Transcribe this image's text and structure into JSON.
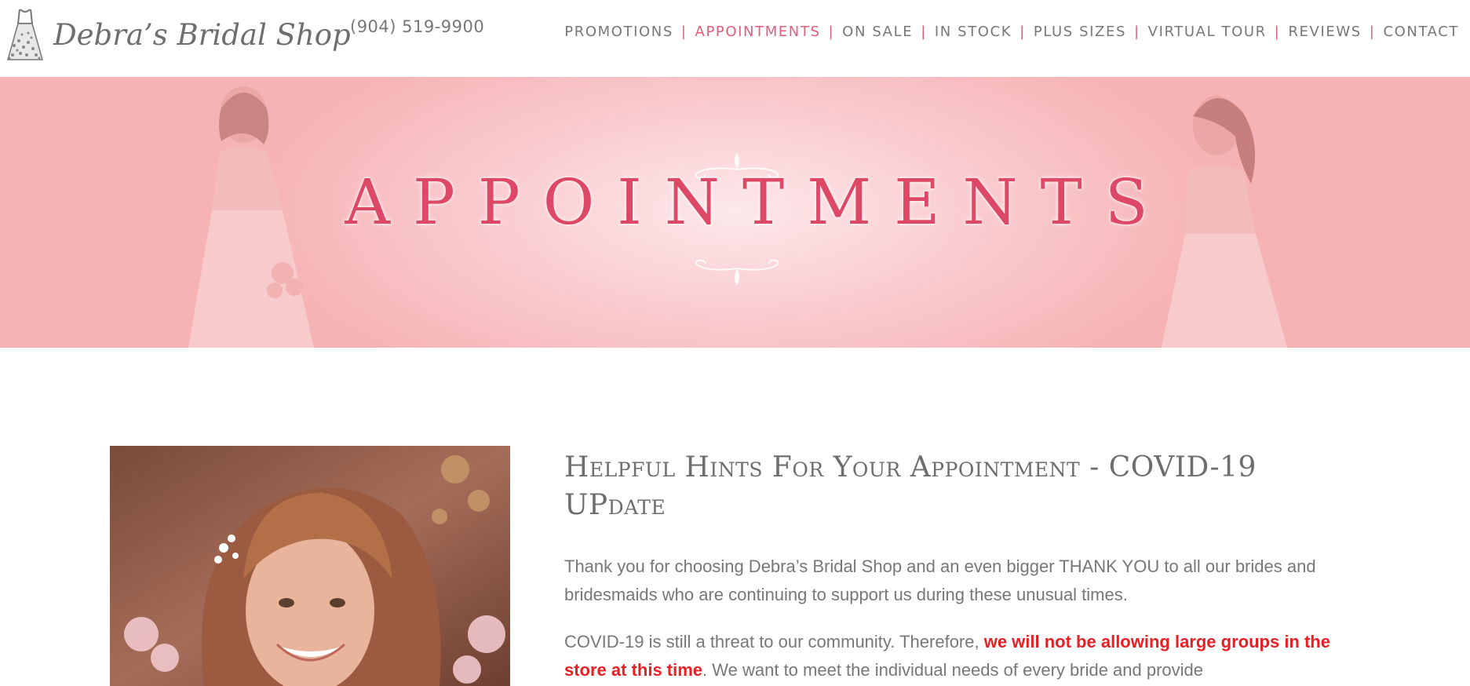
{
  "header": {
    "logo_text": "Debra’s Bridal Shop",
    "phone": "(904) 519-9900",
    "nav": [
      {
        "label": "PROMOTIONS",
        "active": false
      },
      {
        "label": "APPOINTMENTS",
        "active": true
      },
      {
        "label": "ON SALE",
        "active": false
      },
      {
        "label": "IN STOCK",
        "active": false
      },
      {
        "label": "PLUS SIZES",
        "active": false
      },
      {
        "label": "VIRTUAL TOUR",
        "active": false
      },
      {
        "label": "REVIEWS",
        "active": false
      },
      {
        "label": "CONTACT",
        "active": false
      }
    ],
    "separator": "|"
  },
  "hero": {
    "title": "APPOINTMENTS"
  },
  "main": {
    "heading": "Helpful Hints For Your Appointment - COVID-19 UPdate",
    "paragraph1": "Thank you for choosing Debra’s Bridal Shop and an even bigger THANK YOU to all our brides and bridesmaids who are continuing to support us during these unusual times.",
    "paragraph2_pre": "COVID-19 is still a threat to our community. Therefore, ",
    "paragraph2_emphasis": "we will not be allowing large groups in the store at this time",
    "paragraph2_post": ". We want to meet the individual needs of every bride and provide"
  },
  "colors": {
    "accent": "#e05d7a",
    "hero_title": "#dc4866",
    "emphasis": "#ea1f24",
    "text": "#777777"
  }
}
